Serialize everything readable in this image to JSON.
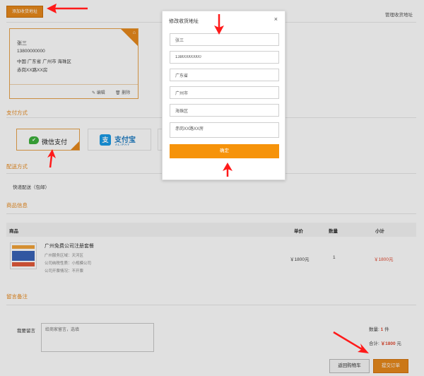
{
  "address": {
    "add_button": "添加收货地址",
    "manage_link": "管理收货地址",
    "card": {
      "name": "张三",
      "phone": "13800000000",
      "region": "中国 广东省 广州市 海珠区",
      "detail": "赤岗XX路XX房",
      "edit_label": "编辑",
      "delete_label": "删除"
    }
  },
  "payment": {
    "title": "支付方式",
    "wechat_label": "微信支付",
    "alipay_label": "支付宝",
    "alipay_sub": "ALIPAY"
  },
  "shipping": {
    "title": "配送方式",
    "method": "快递配送（包邮）"
  },
  "goods": {
    "title": "商品信息",
    "headers": {
      "product": "商品",
      "price": "单价",
      "qty": "数量",
      "subtotal": "小计"
    },
    "item": {
      "name": "广州免费公司注册套餐",
      "attrs": [
        "广州服务区域：天河区",
        "公司纳税性质：小规模公司",
        "公司开票情况：不开票"
      ],
      "price": "￥1800元",
      "qty": "1",
      "subtotal": "￥1800元"
    }
  },
  "remark": {
    "title": "留言备注",
    "label": "我要留言",
    "placeholder": "给商家留言，选填"
  },
  "summary": {
    "count_label": "数量:",
    "count_value": "1",
    "count_unit": "件",
    "total_label": "合计:",
    "total_value": "￥1800",
    "total_unit": "元",
    "back_button": "返回购物车",
    "submit_button": "提交订单"
  },
  "modal": {
    "title": "修改收货地址",
    "close": "×",
    "name": "张三",
    "phone": "13800000000",
    "province": "广东省",
    "city": "广州市",
    "district": "海珠区",
    "detail": "赤岗XX路XX房",
    "confirm": "确定"
  },
  "colors": {
    "accent": "#e8891c",
    "price": "#e0482f",
    "annotation_arrow": "#ff1a1a"
  }
}
